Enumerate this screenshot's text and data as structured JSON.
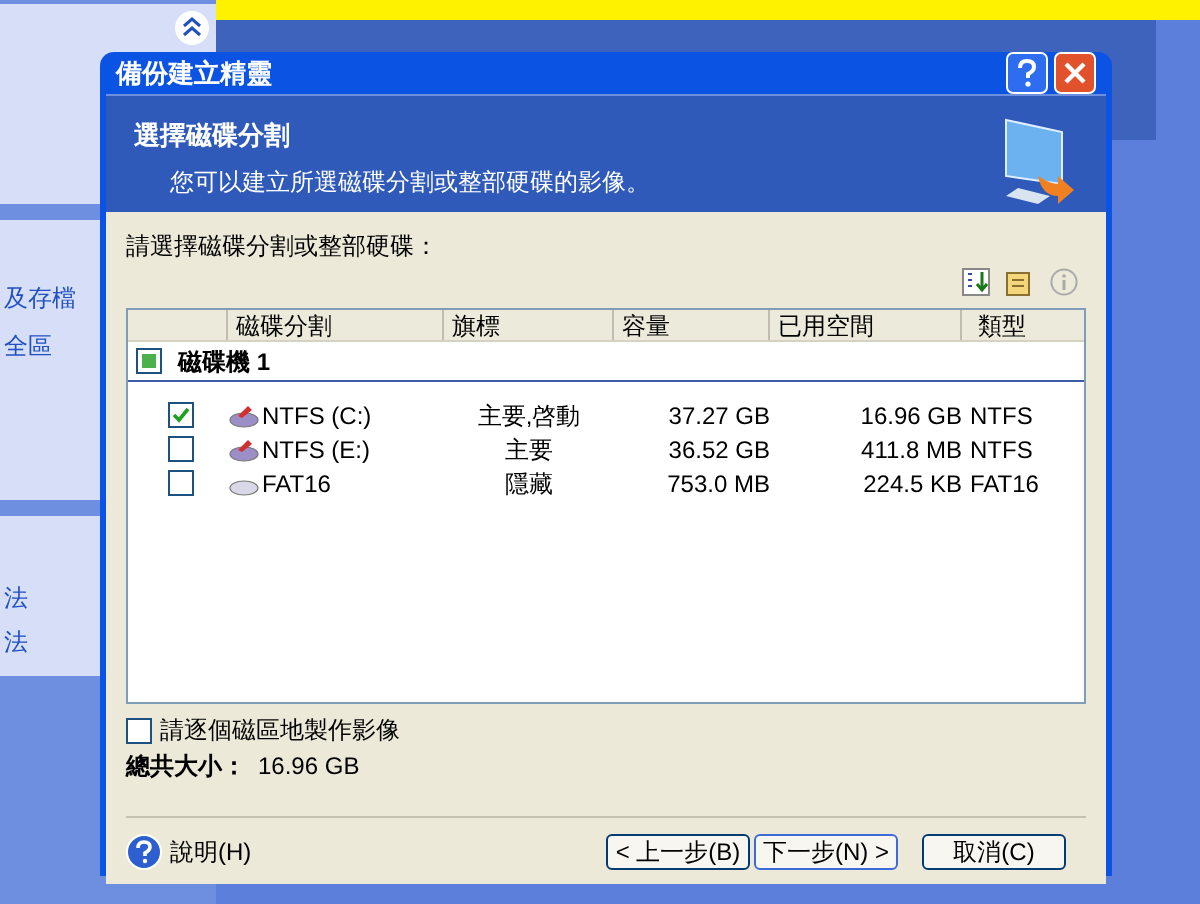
{
  "background": {
    "sidebar_items": [
      "及存檔",
      "全區",
      "法",
      "法"
    ]
  },
  "dialog": {
    "title": "備份建立精靈",
    "header": {
      "title": "選擇磁碟分割",
      "subtitle": "您可以建立所選磁碟分割或整部硬碟的影像。"
    },
    "prompt": "請選擇磁碟分割或整部硬碟：",
    "table": {
      "columns": [
        "磁碟分割",
        "旗標",
        "容量",
        "已用空間",
        "類型"
      ],
      "group": {
        "label": "磁碟機 1",
        "checked": true
      },
      "rows": [
        {
          "checked": true,
          "kind": "ntfs",
          "name": "NTFS (C:)",
          "flags": "主要,啓動",
          "capacity": "37.27 GB",
          "used": "16.96 GB",
          "type": "NTFS"
        },
        {
          "checked": false,
          "kind": "ntfs",
          "name": "NTFS (E:)",
          "flags": "主要",
          "capacity": "36.52 GB",
          "used": "411.8 MB",
          "type": "NTFS"
        },
        {
          "checked": false,
          "kind": "hidden",
          "name": "FAT16",
          "flags": "隱藏",
          "capacity": "753.0 MB",
          "used": "224.5 KB",
          "type": "FAT16"
        }
      ]
    },
    "per_sector": {
      "label": "請逐個磁區地製作影像",
      "checked": false
    },
    "total": {
      "label": "總共大小：",
      "value": "16.96 GB"
    },
    "help": "說明(H)",
    "buttons": [
      "< 上一步(B)",
      "下一步(N) >",
      "取消(C)"
    ]
  }
}
